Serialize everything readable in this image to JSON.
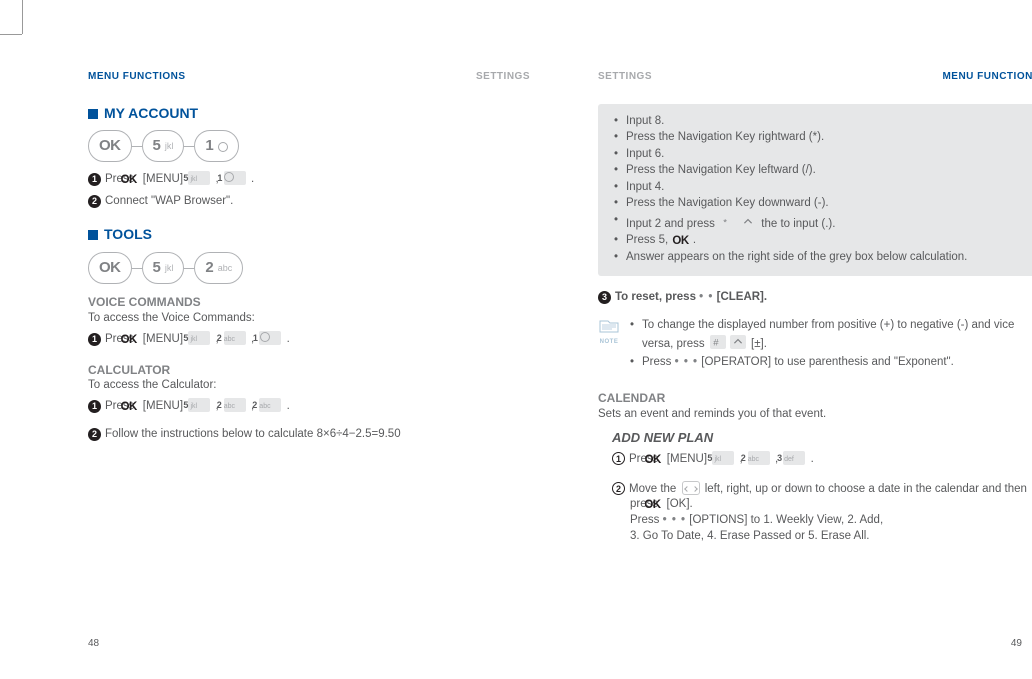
{
  "left": {
    "header": {
      "menu": "MENU FUNCTIONS",
      "settings": "SETTINGS"
    },
    "myAccount": {
      "title": "MY ACCOUNT",
      "pills": {
        "ok": "OK",
        "k5num": "5",
        "k5let": "jkl",
        "k1num": "1"
      },
      "step1_pre": "Press ",
      "step1_menu": "[MENU]",
      "step1_period": ".",
      "step2": "Connect \"WAP Browser\"."
    },
    "tools": {
      "title": "TOOLS",
      "pills": {
        "ok": "OK",
        "k5num": "5",
        "k5let": "jkl",
        "k2num": "2",
        "k2let": "abc"
      },
      "voice": {
        "title": "VOICE COMMANDS",
        "intro": "To access the Voice Commands:",
        "press": "Press ",
        "menu": "[MENU]"
      },
      "calc": {
        "title": "CALCULATOR",
        "intro": "To access the Calculator:",
        "press": "Press ",
        "menu": "[MENU]",
        "step2": "Follow the instructions below to calculate  8×6÷4−2.5=9.50"
      }
    },
    "pageNum": "48"
  },
  "right": {
    "header": {
      "settings": "SETTINGS",
      "menu": "MENU FUNCTIONS"
    },
    "greybox": {
      "i1": "Input 8.",
      "i2": "Press the Navigation Key rightward (*).",
      "i3": "Input 6.",
      "i4": "Press the Navigation Key leftward (/).",
      "i5": "Input 4.",
      "i6": "Press the Navigation Key downward (-).",
      "i7a": "Input 2 and press ",
      "i7b": "the to input (.).",
      "i8a": "Press 5, ",
      "i8b": ".",
      "i9": "Answer appears on the right side of the grey box below calculation."
    },
    "step3a": "To reset, press ",
    "step3b": "[CLEAR].",
    "note": {
      "l1": "To change the displayed number from positive (+) to negative (-) and vice versa, press ",
      "l1b": "[±].",
      "l2a": "Press ",
      "l2b": "[OPERATOR] to use parenthesis and \"Exponent\"."
    },
    "calendar": {
      "title": "CALENDAR",
      "desc": "Sets an event and reminds you of that event.",
      "plan": "ADD NEW PLAN",
      "press": "Press ",
      "menu": "[MENU]",
      "step2a": "Move the ",
      "step2b": "left, right, up or down to choose a date in the calendar and then press ",
      "step2c": "[OK].",
      "step2d": "Press ",
      "step2e": "[OPTIONS] to 1. Weekly View, 2. Add,",
      "step2f": "3. Go To Date, 4. Erase Passed or 5. Erase All."
    },
    "pageNum": "49"
  },
  "keys": {
    "k5": {
      "n": "5",
      "l": "jkl"
    },
    "k2": {
      "n": "2",
      "l": "abc"
    },
    "k1": {
      "n": "1",
      "l": ""
    },
    "k3": {
      "n": "3",
      "l": "def"
    }
  }
}
